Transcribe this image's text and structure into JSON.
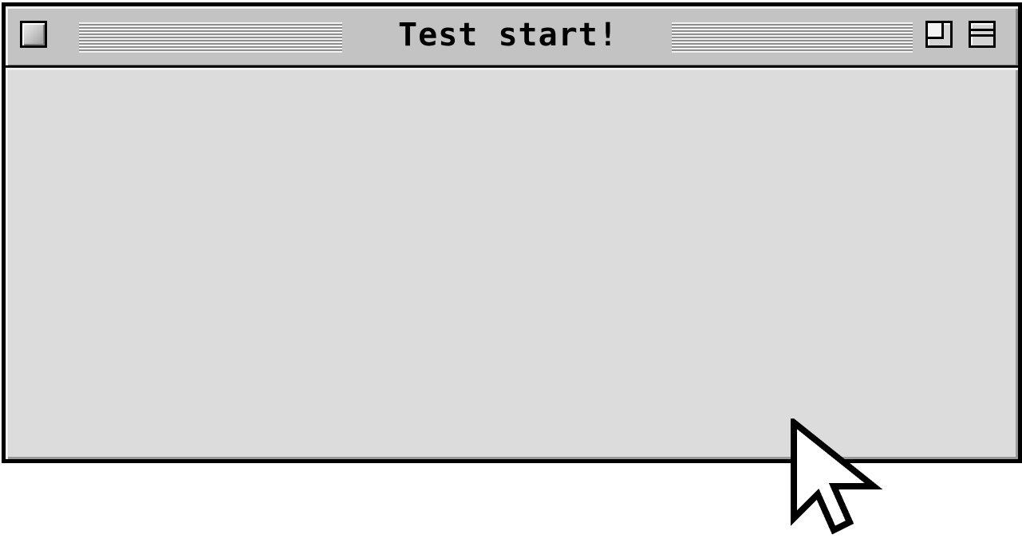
{
  "window": {
    "title": "Test start!",
    "colors": {
      "titlebar": "#c3c3c3",
      "content": "#dcdcdc",
      "border": "#000000"
    }
  },
  "icons": {
    "close": "close-box-icon",
    "zoom": "zoom-box-icon",
    "collapse": "collapse-box-icon",
    "cursor": "arrow-cursor-icon"
  }
}
